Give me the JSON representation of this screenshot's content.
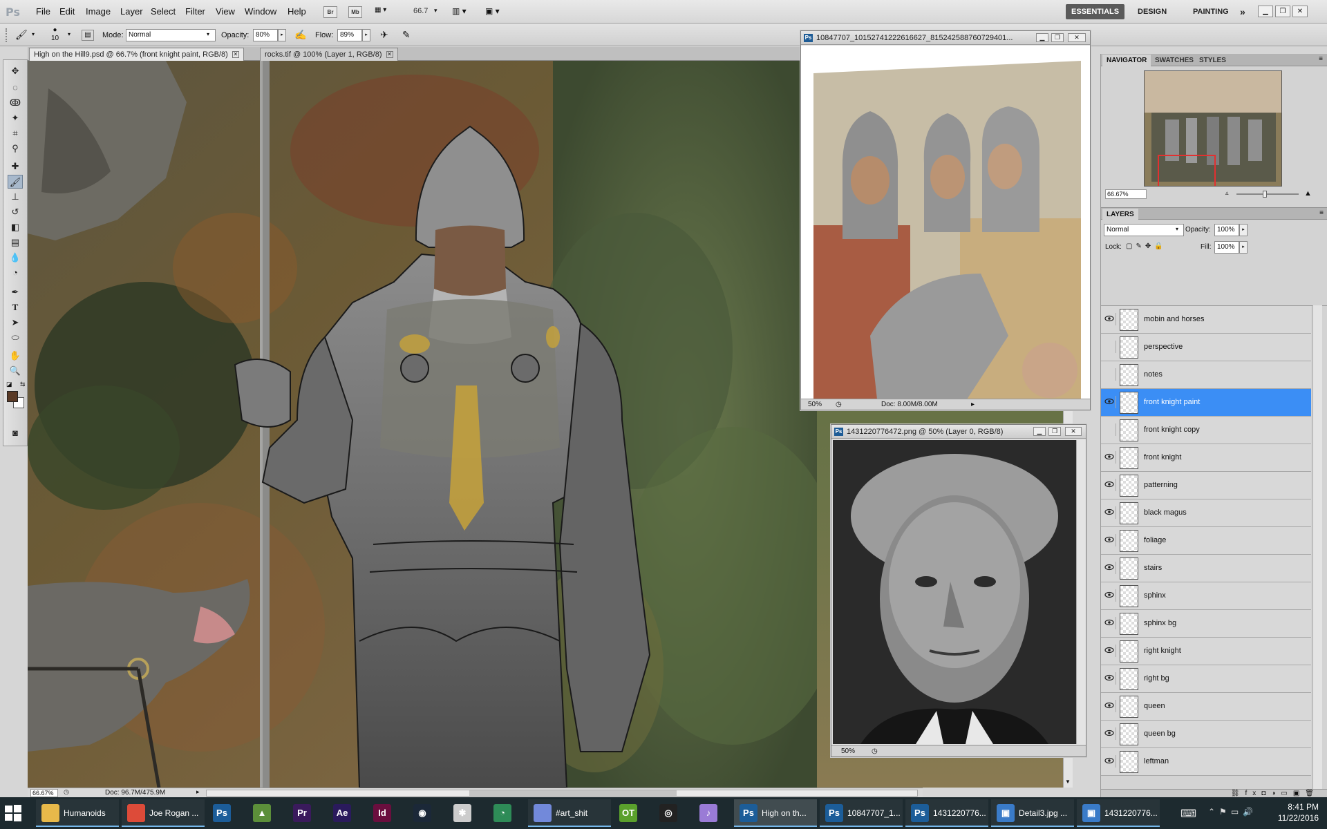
{
  "app": {
    "logo": "Ps"
  },
  "menu": [
    "File",
    "Edit",
    "Image",
    "Layer",
    "Select",
    "Filter",
    "View",
    "Window",
    "Help"
  ],
  "menubar": {
    "zoom_value": "66.7",
    "br_label": "Br",
    "mb_label": "Mb"
  },
  "workspaces": {
    "essentials": "ESSENTIALS",
    "design": "DESIGN",
    "painting": "PAINTING",
    "more": "»"
  },
  "options": {
    "brush_size": "10",
    "mode_label": "Mode:",
    "mode_value": "Normal",
    "opacity_label": "Opacity:",
    "opacity_value": "80%",
    "flow_label": "Flow:",
    "flow_value": "89%"
  },
  "doc_tabs": [
    {
      "label": "High on the Hill9.psd @ 66.7% (front knight paint, RGB/8)"
    },
    {
      "label": "rocks.tif @ 100% (Layer 1, RGB/8)"
    }
  ],
  "status": {
    "zoom": "66.67%",
    "doc": "Doc: 96.7M/475.9M"
  },
  "float1": {
    "title": "10847707_10152741222616627_8152425887607294​01...",
    "zoom": "50%",
    "doc": "Doc: 8.00M/8.00M"
  },
  "float2": {
    "title": "1431220776472.png @ 50% (Layer 0, RGB/8)",
    "zoom": "50%"
  },
  "navigator": {
    "tabs": [
      "NAVIGATOR",
      "SWATCHES",
      "STYLES"
    ],
    "zoom": "66.67%"
  },
  "layers_panel": {
    "title": "LAYERS",
    "blend_mode": "Normal",
    "opacity_label": "Opacity:",
    "opacity_value": "100%",
    "lock_label": "Lock:",
    "fill_label": "Fill:",
    "fill_value": "100%",
    "layers": [
      {
        "name": "mobin and horses",
        "visible": true,
        "selected": false
      },
      {
        "name": "perspective",
        "visible": false,
        "selected": false
      },
      {
        "name": "notes",
        "visible": false,
        "selected": false
      },
      {
        "name": "front knight paint",
        "visible": true,
        "selected": true
      },
      {
        "name": "front knight copy",
        "visible": false,
        "selected": false
      },
      {
        "name": "front knight",
        "visible": true,
        "selected": false
      },
      {
        "name": "patterning",
        "visible": true,
        "selected": false
      },
      {
        "name": "black magus",
        "visible": true,
        "selected": false
      },
      {
        "name": "foliage",
        "visible": true,
        "selected": false
      },
      {
        "name": "stairs",
        "visible": true,
        "selected": false
      },
      {
        "name": "sphinx",
        "visible": true,
        "selected": false
      },
      {
        "name": "sphinx bg",
        "visible": true,
        "selected": false
      },
      {
        "name": "right knight",
        "visible": true,
        "selected": false
      },
      {
        "name": "right bg",
        "visible": true,
        "selected": false
      },
      {
        "name": "queen",
        "visible": true,
        "selected": false
      },
      {
        "name": "queen bg",
        "visible": true,
        "selected": false
      },
      {
        "name": "leftman",
        "visible": true,
        "selected": false
      }
    ]
  },
  "taskbar": {
    "apps": [
      {
        "icon": "folder-icon",
        "label": "Humanoids",
        "color": "#e8b94a",
        "state": "open"
      },
      {
        "icon": "chrome-icon",
        "label": "Joe Rogan ...",
        "color": "#dd4b39",
        "state": "open"
      },
      {
        "icon": "photoshop-icon",
        "label": "",
        "glyph": "Ps",
        "color": "#1c5d99",
        "state": "none"
      },
      {
        "icon": "app-icon",
        "label": "",
        "glyph": "▲",
        "color": "#5c8f3a",
        "state": "none"
      },
      {
        "icon": "premiere-icon",
        "label": "",
        "glyph": "Pr",
        "color": "#3a1a5c",
        "state": "none"
      },
      {
        "icon": "aftereffects-icon",
        "label": "",
        "glyph": "Ae",
        "color": "#2a1a5c",
        "state": "none"
      },
      {
        "icon": "indesign-icon",
        "label": "",
        "glyph": "Id",
        "color": "#6a0e3e",
        "state": "none"
      },
      {
        "icon": "steam-icon",
        "label": "",
        "glyph": "◉",
        "color": "#1b2838",
        "state": "none"
      },
      {
        "icon": "app-icon",
        "label": "",
        "glyph": "✱",
        "color": "#cccccc",
        "state": "none"
      },
      {
        "icon": "chart-app-icon",
        "label": "",
        "glyph": "◔",
        "color": "#2e8b57",
        "state": "none"
      },
      {
        "icon": "discord-icon",
        "label": "#art_shit",
        "color": "#7289da",
        "state": "open"
      },
      {
        "icon": "app-icon",
        "label": "",
        "glyph": "OT",
        "color": "#5aa02c",
        "state": "none"
      },
      {
        "icon": "obs-icon",
        "label": "",
        "glyph": "◎",
        "color": "#222222",
        "state": "none"
      },
      {
        "icon": "itunes-icon",
        "label": "",
        "glyph": "♪",
        "color": "#9a7bd6",
        "state": "none"
      },
      {
        "icon": "photoshop-icon",
        "label": "High on th...",
        "glyph": "Ps",
        "color": "#1c5d99",
        "state": "focus"
      },
      {
        "icon": "photoshop-icon",
        "label": "10847707_1...",
        "glyph": "Ps",
        "color": "#1c5d99",
        "state": "open"
      },
      {
        "icon": "photoshop-icon",
        "label": "1431220776...",
        "glyph": "Ps",
        "color": "#1c5d99",
        "state": "open"
      },
      {
        "icon": "image-viewer-icon",
        "label": "Detail3.jpg ...",
        "glyph": "▣",
        "color": "#3a7bc8",
        "state": "open"
      },
      {
        "icon": "image-viewer-icon",
        "label": "1431220776...",
        "glyph": "▣",
        "color": "#3a7bc8",
        "state": "open"
      }
    ],
    "time": "8:41 PM",
    "date": "11/22/2016"
  },
  "colors": {
    "selected_layer": "#3b8ef5",
    "foreground": "#5a3a26",
    "background": "#ffffff",
    "taskbar": "#1d2a2f"
  }
}
